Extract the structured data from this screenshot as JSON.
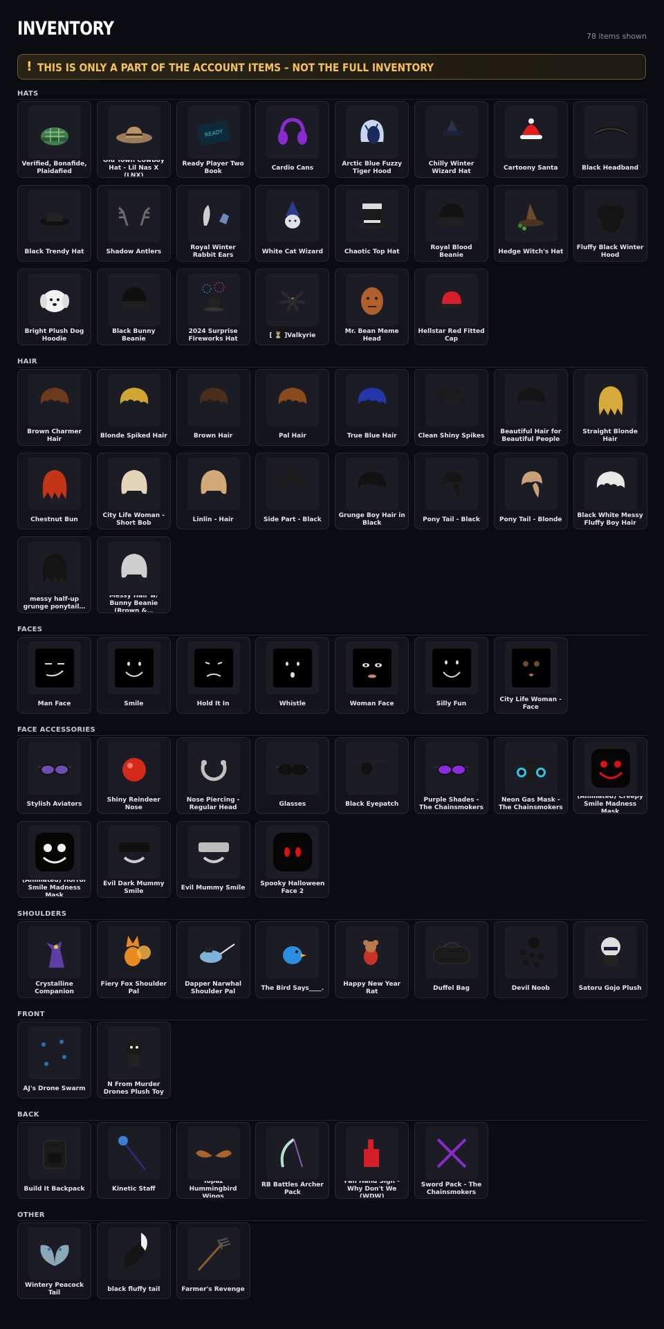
{
  "header": {
    "title": "INVENTORY",
    "count": "78 items shown"
  },
  "banner": {
    "icon": "!",
    "text": "THIS IS ONLY A PART OF THE ACCOUNT ITEMS – NOT THE FULL INVENTORY"
  },
  "sections": [
    {
      "title": "HATS",
      "items": [
        {
          "label": "Verified, Bonafide, Plaidafied",
          "icon": "cap",
          "color": "#3f7d4a"
        },
        {
          "label": "Old Town Cowboy Hat - Lil Nas X (LNX)",
          "icon": "cowboy",
          "color": "#9a7c5a"
        },
        {
          "label": "Ready Player Two Book",
          "icon": "book",
          "color": "#46b8c8"
        },
        {
          "label": "Cardio Cans",
          "icon": "headphones",
          "color": "#8a2bd0"
        },
        {
          "label": "Arctic Blue Fuzzy Tiger Hood",
          "icon": "hood",
          "color": "#c9d6f0"
        },
        {
          "label": "Chilly Winter Wizard Hat",
          "icon": "wizard",
          "color": "#2a3450"
        },
        {
          "label": "Cartoony Santa",
          "icon": "santa",
          "color": "#e01e1e"
        },
        {
          "label": "Black Headband",
          "icon": "band",
          "color": "#151515"
        },
        {
          "label": "Black Trendy Hat",
          "icon": "bowler",
          "color": "#222222"
        },
        {
          "label": "Shadow Antlers",
          "icon": "antlers",
          "color": "#6c6c6c"
        },
        {
          "label": "Royal Winter Rabbit Ears",
          "icon": "ears",
          "color": "#cfcfcf"
        },
        {
          "label": "White Cat Wizard",
          "icon": "catwiz",
          "color": "#2e3a8a"
        },
        {
          "label": "Chaotic Top Hat",
          "icon": "tophat",
          "color": "#dcdcdc"
        },
        {
          "label": "Royal Blood Beanie",
          "icon": "beanie",
          "color": "#121212"
        },
        {
          "label": "Hedge Witch's Hat",
          "icon": "witch",
          "color": "#6b4b2b"
        },
        {
          "label": "Fluffy Black Winter Hood",
          "icon": "fluffy",
          "color": "#141414"
        },
        {
          "label": "Bright Plush Dog Hoodie",
          "icon": "dog",
          "color": "#f2f2f2"
        },
        {
          "label": "Black Bunny Beanie",
          "icon": "beanie",
          "color": "#0f0f0f"
        },
        {
          "label": "2024 Surprise Fireworks Hat",
          "icon": "fireworks",
          "color": "#2a9bd8"
        },
        {
          "label": "[ ⏳ ]Valkyrie",
          "icon": "valkyrie",
          "color": "#2a2a2a"
        },
        {
          "label": "Mr. Bean Meme Head",
          "icon": "headface",
          "color": "#b0602f"
        },
        {
          "label": "Hellstar Red Fitted Cap",
          "icon": "redcap",
          "color": "#d81e2a"
        }
      ]
    },
    {
      "title": "HAIR",
      "items": [
        {
          "label": "Brown Charmer Hair",
          "icon": "hair",
          "color": "#6e3a1e"
        },
        {
          "label": "Blonde Spiked Hair",
          "icon": "hair",
          "color": "#d1a534"
        },
        {
          "label": "Brown Hair",
          "icon": "hair",
          "color": "#4a2d1a"
        },
        {
          "label": "Pal Hair",
          "icon": "hair",
          "color": "#8a4a1c"
        },
        {
          "label": "True Blue Hair",
          "icon": "hair",
          "color": "#2436a8"
        },
        {
          "label": "Clean Shiny Spikes",
          "icon": "hair",
          "color": "#1a1a1a"
        },
        {
          "label": "Beautiful Hair for Beautiful People",
          "icon": "hair",
          "color": "#151515"
        },
        {
          "label": "Straight Blonde Hair",
          "icon": "longhair",
          "color": "#d5a93a"
        },
        {
          "label": "Chestnut Bun",
          "icon": "longhair",
          "color": "#c23617"
        },
        {
          "label": "City Life Woman - Short Bob",
          "icon": "bob",
          "color": "#e3d6b8"
        },
        {
          "label": "Linlin - Hair",
          "icon": "bob",
          "color": "#d2aa78"
        },
        {
          "label": "Side Part - Black",
          "icon": "hair",
          "color": "#1c1c1c"
        },
        {
          "label": "Grunge Boy Hair in Black",
          "icon": "hair",
          "color": "#121212"
        },
        {
          "label": "Pony Tail - Black",
          "icon": "pony",
          "color": "#161616"
        },
        {
          "label": "Pony Tail - Blonde",
          "icon": "pony",
          "color": "#caa07a"
        },
        {
          "label": "Black White Messy Fluffy Boy Hair",
          "icon": "hair",
          "color": "#e8e8e8"
        },
        {
          "label": "messy half-up grunge ponytail…",
          "icon": "longhair",
          "color": "#141414"
        },
        {
          "label": "Messy Hair w/ Bunny Beanie (Brown &…",
          "icon": "bob",
          "color": "#cfcfcf"
        }
      ]
    },
    {
      "title": "FACES",
      "items": [
        {
          "label": "Man Face",
          "icon": "face-man",
          "color": "#000000"
        },
        {
          "label": "Smile",
          "icon": "face-smile",
          "color": "#000000"
        },
        {
          "label": "Hold It In",
          "icon": "face-hold",
          "color": "#000000"
        },
        {
          "label": "Whistle",
          "icon": "face-whistle",
          "color": "#000000"
        },
        {
          "label": "Woman Face",
          "icon": "face-woman",
          "color": "#000000"
        },
        {
          "label": "Silly Fun",
          "icon": "face-silly",
          "color": "#000000"
        },
        {
          "label": "City Life Woman - Face",
          "icon": "face-city",
          "color": "#000000"
        }
      ]
    },
    {
      "title": "FACE ACCESSORIES",
      "items": [
        {
          "label": "Stylish Aviators",
          "icon": "glasses",
          "color": "#6a4fb0"
        },
        {
          "label": "Shiny Reindeer Nose",
          "icon": "ball",
          "color": "#d42a1c"
        },
        {
          "label": "Nose Piercing - Regular Head",
          "icon": "ring",
          "color": "#c0c0c0"
        },
        {
          "label": "Glasses",
          "icon": "glasses",
          "color": "#111111"
        },
        {
          "label": "Black Eyepatch",
          "icon": "patch",
          "color": "#111111"
        },
        {
          "label": "Purple Shades - The Chainsmokers",
          "icon": "glasses",
          "color": "#8a2be2"
        },
        {
          "label": "Neon Gas Mask - The Chainsmokers",
          "icon": "gasmask",
          "color": "#2bc8e8"
        },
        {
          "label": "(Animated) Creepy Smile Madness Mask",
          "icon": "mask-red",
          "color": "#e01010"
        },
        {
          "label": "(Animated) Horror Smile Madness Mask",
          "icon": "mask-white",
          "color": "#f0f0f0"
        },
        {
          "label": "Evil Dark Mummy Smile",
          "icon": "mummy",
          "color": "#101010"
        },
        {
          "label": "Evil Mummy Smile",
          "icon": "mummy",
          "color": "#bdbdbd"
        },
        {
          "label": "Spooky Halloween Face 2",
          "icon": "mask-eyes",
          "color": "#e01010"
        }
      ]
    },
    {
      "title": "SHOULDERS",
      "items": [
        {
          "label": "Crystalline Companion",
          "icon": "creature",
          "color": "#5b3ea8"
        },
        {
          "label": "Fiery Fox Shoulder Pal",
          "icon": "fox",
          "color": "#e88a22"
        },
        {
          "label": "Dapper Narwhal Shoulder Pal",
          "icon": "narwhal",
          "color": "#7fb2d8"
        },
        {
          "label": "The Bird Says____.",
          "icon": "bird",
          "color": "#2a8fe0"
        },
        {
          "label": "Happy New Year Rat",
          "icon": "rat",
          "color": "#c9342a"
        },
        {
          "label": "Duffel Bag",
          "icon": "duffel",
          "color": "#1a1a1a"
        },
        {
          "label": "Devil Noob",
          "icon": "dots",
          "color": "#0e0e0e"
        },
        {
          "label": "Satoru Gojo Plush",
          "icon": "plush",
          "color": "#dedede"
        }
      ]
    },
    {
      "title": "FRONT",
      "items": [
        {
          "label": "AJ's Drone Swarm",
          "icon": "drones",
          "color": "#2a6fb8"
        },
        {
          "label": "N From Murder Drones Plush Toy",
          "icon": "plushN",
          "color": "#1a1a1a"
        }
      ]
    },
    {
      "title": "BACK",
      "items": [
        {
          "label": "Build It Backpack",
          "icon": "backpack",
          "color": "#1a1a1a"
        },
        {
          "label": "Kinetic Staff",
          "icon": "staff",
          "color": "#3a7fd0"
        },
        {
          "label": "Topaz Hummingbird Wings",
          "icon": "wings",
          "color": "#a8642a"
        },
        {
          "label": "RB Battles Archer Pack",
          "icon": "bow",
          "color": "#b8e0d0"
        },
        {
          "label": "Fan Hand Sign - Why Don't We (WDW)",
          "icon": "foamhand",
          "color": "#d41e2a"
        },
        {
          "label": "Sword Pack - The Chainsmokers",
          "icon": "swords",
          "color": "#8a2bd0"
        }
      ]
    },
    {
      "title": "OTHER",
      "items": [
        {
          "label": "Wintery Peacock Tail",
          "icon": "peacock",
          "color": "#8aa8b8"
        },
        {
          "label": "black fluffy tail",
          "icon": "tail",
          "color": "#151515"
        },
        {
          "label": "Farmer's Revenge",
          "icon": "pitchfork",
          "color": "#8a5a2a"
        }
      ]
    }
  ]
}
